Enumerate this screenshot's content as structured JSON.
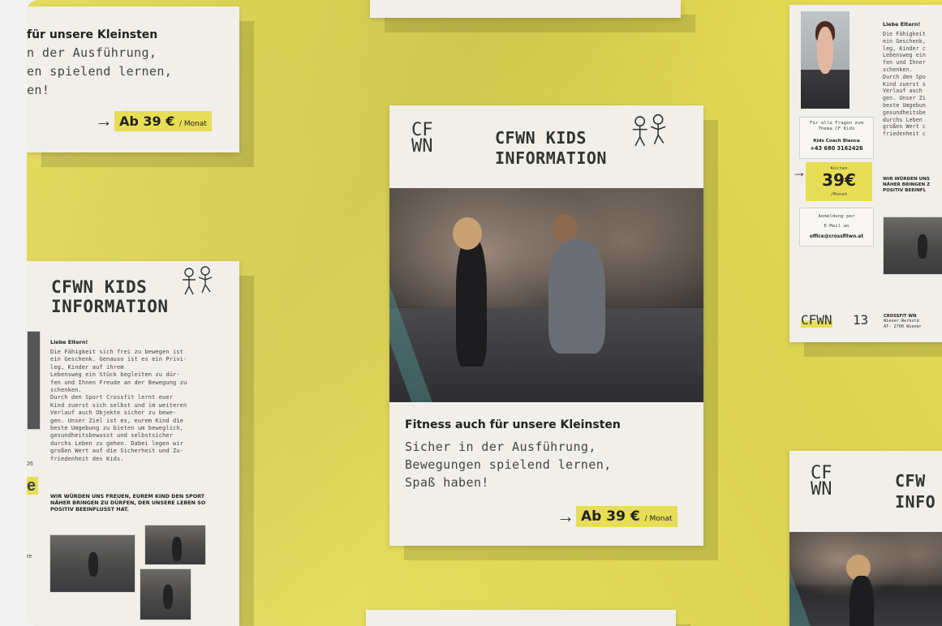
{
  "colors": {
    "accent": "#e7de55",
    "paper": "#f1efe9",
    "ink": "#333333"
  },
  "icons": [
    "arrow-right-icon",
    "kids-figures-icon"
  ],
  "center_poster": {
    "logo_top": "CF",
    "logo_bottom": "WN",
    "title_line1": "CFWN KIDS",
    "title_line2": "INFORMATION",
    "subtitle": "Fitness auch für unsere Kleinsten",
    "body_line1": "Sicher in der Ausführung,",
    "body_line2": "Bewegungen spielend lernen,",
    "body_line3": "Spaß haben!",
    "price": "Ab 39 €",
    "price_unit": "/ Monat"
  },
  "top_left_poster": {
    "subtitle": "für unsere Kleinsten",
    "body_line1": "n der Ausführung,",
    "body_line2": "en spielend lernen,",
    "body_line3": "en!",
    "price": "Ab 39 €",
    "price_unit": "/ Monat"
  },
  "left_poster": {
    "title_line1": "CFWN KIDS",
    "title_line2": "INFORMATION",
    "greeting": "Liebe Eltern!",
    "body": [
      "Die Fähigkeit sich frei zu bewegen ist",
      "ein Geschenk. Genauso ist es ein Privi-",
      "leg, Kinder auf ihrem",
      "Lebensweg ein Stück begleiten zu dür-",
      "fen und Ihnen Freude an der Bewegung zu",
      "schenken.",
      "Durch den Sport Crossfit lernt euer",
      "Kind zuerst sich selbst und im weiteren",
      "Verlauf auch Objekte sicher zu bewe-",
      "gen. Unser Ziel ist es, eurem Kind die",
      "beste Umgebung zu bieten um beweglich,",
      "gesundheitsbewusst und selbstsicher",
      "durchs Leben zu gehen. Dabei legen wir",
      "großen Wert auf die Sicherheit und Zu-",
      "friedenheit des Kids."
    ],
    "closing": [
      "WIR WÜRDEN UNS FREUEN, EUREM KIND DEN SPORT",
      "NÄHER BRINGEN ZU DÜRFEN, DER UNSERE LEBEN SO",
      "POSITIV BEEINFLUSST HAT."
    ],
    "edge_text": [
      "e",
      "26",
      "re"
    ]
  },
  "right_poster": {
    "greeting": "Liebe Eltern!",
    "body": [
      "Die Fähigkeit",
      "ein Geschenk,",
      "leg, Kinder c",
      "Lebensweg ein",
      "fen und Ihner",
      "schenken.",
      "Durch den Spo",
      "Kind zuerst s",
      "Verlauf auch",
      "gen. Unser Zi",
      "beste Umgebun",
      "gesundheitsbe",
      "durchs Leben",
      "großen Wert c",
      "friedenheit c"
    ],
    "questions_line1": "Für alle Fragen zum",
    "questions_line2": "Thema CF Kids",
    "coach_name": "Kids Coach Bianca",
    "coach_phone": "+43 680 3162426",
    "cost_label": "Kosten",
    "cost_value": "39€",
    "cost_unit": "/Monat",
    "register_line1": "Anmeldung per",
    "register_line2": "E-Mail an",
    "register_email": "office@crossfitwn.at",
    "closing": [
      "WIR WÜRDEN UNS",
      "NÄHER BRINGEN Z",
      "POSITIV BEEINFL"
    ],
    "footer_logo": "CFWN",
    "footer_number": "13",
    "footer_addr1": "CROSSFIT WN",
    "footer_addr2": "Wiener Werkstä",
    "footer_addr3": "AT- 2700 Wiener"
  },
  "bottom_right_poster": {
    "logo_top": "CF",
    "logo_bottom": "WN",
    "title_line1": "CFW",
    "title_line2": "INFO"
  }
}
